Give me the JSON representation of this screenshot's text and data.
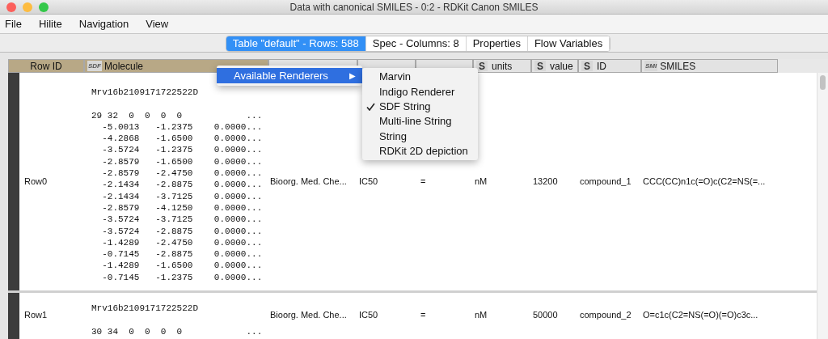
{
  "window": {
    "title": "Data with canonical SMILES - 0:2 - RDKit Canon SMILES"
  },
  "menu_bar": [
    "File",
    "Hilite",
    "Navigation",
    "View"
  ],
  "tabs": [
    {
      "label": "Table \"default\" - Rows: 588",
      "selected": true
    },
    {
      "label": "Spec - Columns: 8",
      "selected": false
    },
    {
      "label": "Properties",
      "selected": false
    },
    {
      "label": "Flow Variables",
      "selected": false
    }
  ],
  "table": {
    "columns": [
      {
        "name": "Row ID",
        "highlighted": true
      },
      {
        "name": "Molecule",
        "badge": "SDF",
        "highlighted": true
      },
      {
        "highlighted": false
      },
      {
        "highlighted": false
      },
      {
        "highlighted": false
      },
      {
        "name": "units",
        "badge": "S",
        "highlighted": false
      },
      {
        "name": "value",
        "badge": "S",
        "highlighted": false
      },
      {
        "name": "ID",
        "badge": "S",
        "highlighted": false
      },
      {
        "name": "SMILES",
        "badge": "SMI",
        "highlighted": false
      }
    ],
    "rows": [
      {
        "cells": [
          "Row0",
          "Mrv16b2109171722522D\n\n29 32  0  0  0  0            ...\n  -5.0013   -1.2375    0.0000...\n  -4.2868   -1.6500    0.0000...\n  -3.5724   -1.2375    0.0000...\n  -2.8579   -1.6500    0.0000...\n  -2.8579   -2.4750    0.0000...\n  -2.1434   -2.8875    0.0000...\n  -2.1434   -3.7125    0.0000...\n  -2.8579   -4.1250    0.0000...\n  -3.5724   -3.7125    0.0000...\n  -3.5724   -2.8875    0.0000...\n  -1.4289   -2.4750    0.0000...\n  -0.7145   -2.8875    0.0000...\n  -1.4289   -1.6500    0.0000...\n  -0.7145   -1.2375    0.0000...",
          "Bioorg. Med. Che...",
          "IC50",
          "=",
          "nM",
          "13200",
          "compound_1",
          "CCC(CC)n1c(=O)c(C2=NS(=..."
        ]
      },
      {
        "cells": [
          "Row1",
          "Mrv16b2109171722522D\n\n30 34  0  0  0  0            ...",
          "Bioorg. Med. Che...",
          "IC50",
          "=",
          "nM",
          "50000",
          "compound_2",
          "O=c1c(C2=NS(=O)(=O)c3c..."
        ]
      }
    ]
  },
  "context_menu": {
    "item": {
      "label": "Available Renderers",
      "arrow": "▶",
      "expanded": true
    },
    "submenu": [
      {
        "label": "Marvin",
        "selected": false
      },
      {
        "label": "Indigo Renderer",
        "selected": false
      },
      {
        "label": "SDF String",
        "selected": true
      },
      {
        "label": "Multi-line String",
        "selected": false
      },
      {
        "label": "String",
        "selected": false
      },
      {
        "label": "RDKit 2D depiction",
        "selected": false
      }
    ]
  }
}
